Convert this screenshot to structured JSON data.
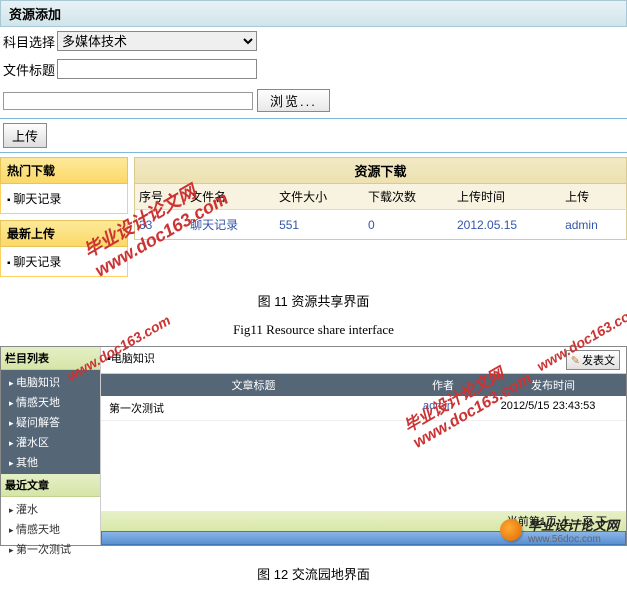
{
  "resource_add": {
    "title": "资源添加",
    "subject_label": "科目选择",
    "subject_value": "多媒体技术",
    "file_title_label": "文件标题",
    "browse_btn": "浏览...",
    "upload_btn": "上传"
  },
  "sidebar_hot": {
    "header": "热门下载",
    "items": [
      {
        "label": "聊天记录"
      }
    ]
  },
  "sidebar_latest": {
    "header": "最新上传",
    "items": [
      {
        "label": "聊天记录"
      }
    ]
  },
  "download_panel": {
    "header": "资源下载",
    "columns": {
      "seq": "序号",
      "filename": "文件名",
      "filesize": "文件大小",
      "count": "下载次数",
      "time": "上传时间",
      "uploader": "上传"
    },
    "rows": [
      {
        "seq": "33",
        "filename": "聊天记录",
        "filesize": "551",
        "count": "0",
        "time": "2012.05.15",
        "uploader": "admin"
      }
    ]
  },
  "caption11_zh": "图 11   资源共享界面",
  "caption11_en": "Fig11    Resource share interface",
  "forum": {
    "section_header": "栏目列表",
    "sections": [
      {
        "label": "电脑知识"
      },
      {
        "label": "情感天地"
      },
      {
        "label": "疑问解答"
      },
      {
        "label": "灌水区"
      },
      {
        "label": "其他"
      }
    ],
    "recent_header": "最近文章",
    "recent": [
      {
        "label": "灌水"
      },
      {
        "label": "情感天地"
      },
      {
        "label": "第一次测试"
      }
    ],
    "location_prefix": "▪电脑知识",
    "post_btn": "发表文",
    "columns": {
      "title": "文章标题",
      "author": "作者",
      "date": "发布时间"
    },
    "rows": [
      {
        "title": "第一次测试",
        "author": "admin",
        "date": "2012/5/15 23:43:53"
      }
    ],
    "pager": "当前第1页 上一页 下一"
  },
  "caption12_zh": "图 12   交流园地界面",
  "watermark_text": "毕业设计论文网",
  "watermark_url": "www.doc163.com",
  "footer": {
    "brand": "毕业设计论文网",
    "url": "www.56doc.com"
  }
}
